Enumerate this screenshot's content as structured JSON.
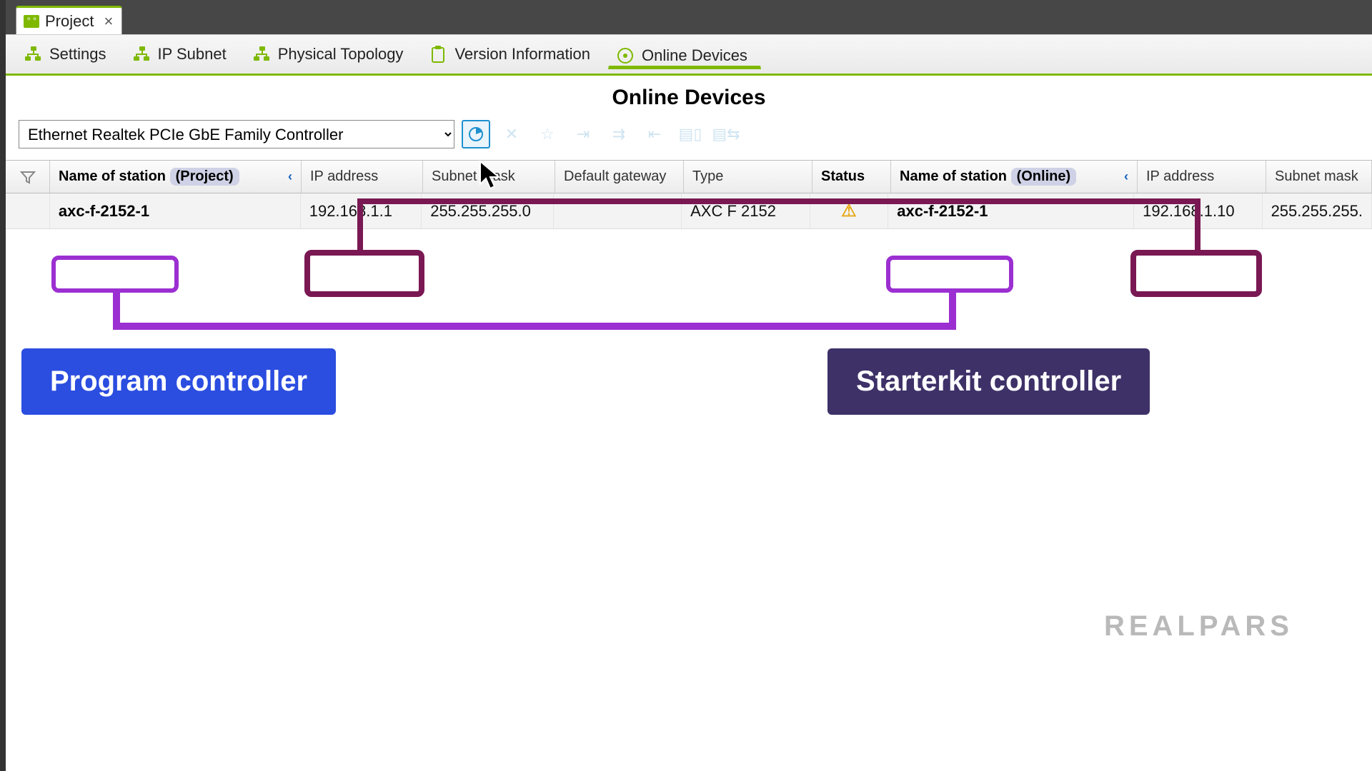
{
  "file_tab": {
    "label": "Project"
  },
  "view_tabs": {
    "settings": "Settings",
    "ip_subnet": "IP Subnet",
    "physical_topology": "Physical Topology",
    "version_info": "Version Information",
    "online_devices": "Online Devices"
  },
  "page_title": "Online Devices",
  "nic": {
    "selected": "Ethernet Realtek PCIe GbE Family Controller"
  },
  "columns": {
    "name_project": "Name of station",
    "name_project_badge": "(Project)",
    "ip": "IP address",
    "subnet": "Subnet mask",
    "gateway": "Default gateway",
    "type": "Type",
    "status": "Status",
    "name_online": "Name of station",
    "name_online_badge": "(Online)",
    "ip2": "IP address",
    "subnet2": "Subnet mask"
  },
  "row": {
    "name_project": "axc-f-2152-1",
    "ip1": "192.168.1.1",
    "subnet1": "255.255.255.0",
    "gateway": "",
    "type": "AXC F 2152",
    "status_icon": "⚠",
    "name_online": "axc-f-2152-1",
    "ip2": "192.168.1.10",
    "subnet2": "255.255.255."
  },
  "callouts": {
    "program": "Program controller",
    "starter": "Starterkit controller"
  },
  "watermark": "REALPARS"
}
